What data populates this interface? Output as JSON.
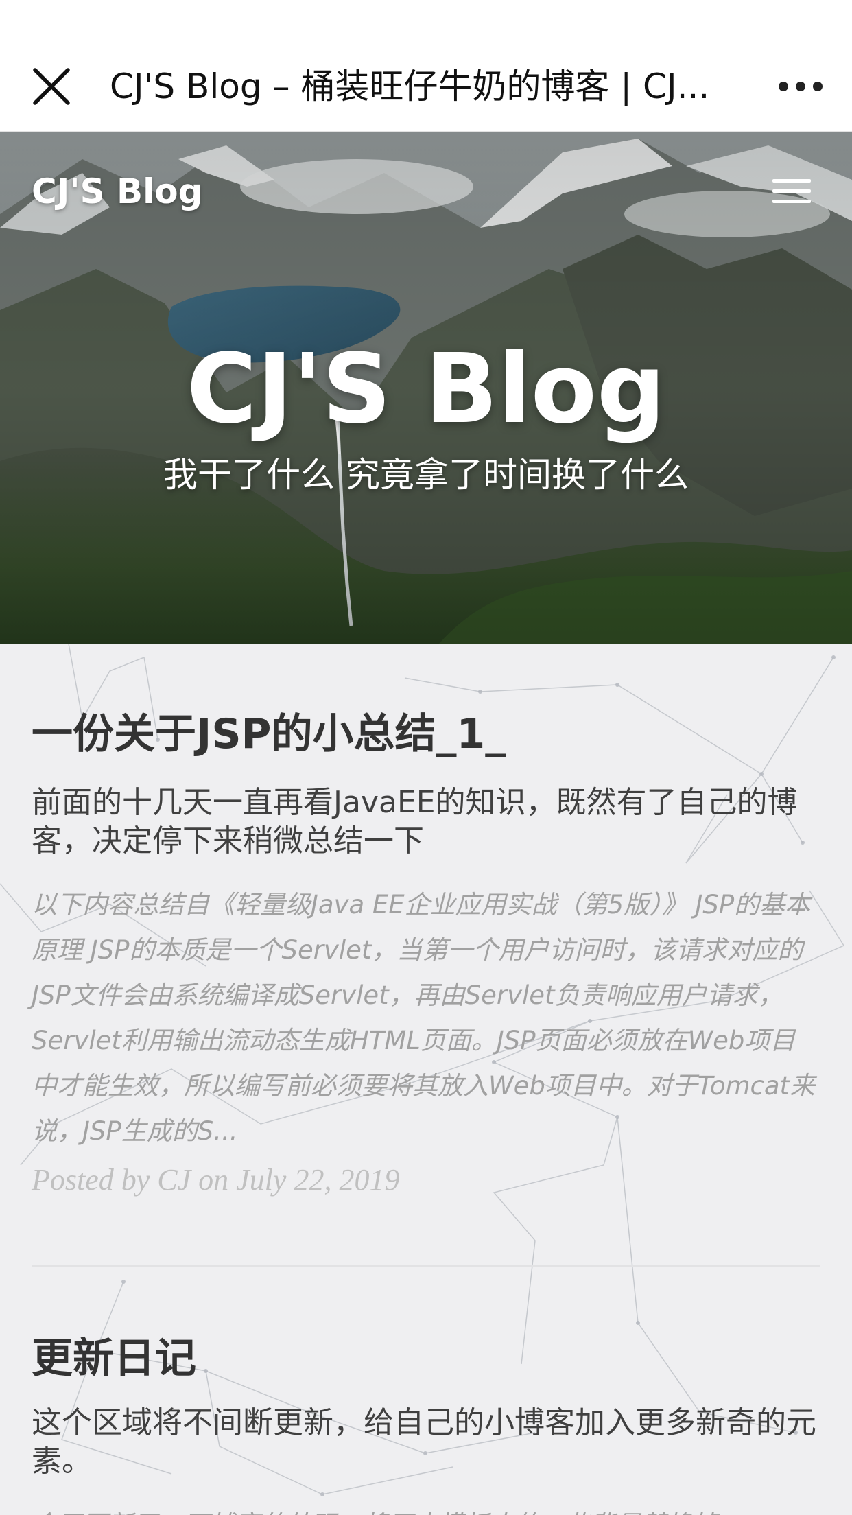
{
  "topbar": {
    "title": "CJ'S Blog – 桶装旺仔牛奶的博客 | CJ..."
  },
  "hero": {
    "brand": "CJ'S Blog",
    "title": "CJ'S Blog",
    "subtitle": "我干了什么 究竟拿了时间换了什么"
  },
  "posts": [
    {
      "title": "一份关于JSP的小总结_1_",
      "subtitle": "前面的十几天一直再看JavaEE的知识，既然有了自己的博客，决定停下来稍微总结一下",
      "excerpt": "以下内容总结自《轻量级Java EE企业应用实战（第5版）》 JSP的基本原理 JSP的本质是一个Servlet，当第一个用户访问时，该请求对应的JSP文件会由系统编译成Servlet，再由Servlet负责响应用户请求， Servlet利用输出流动态生成HTML页面。JSP页面必须放在Web项目中才能生效，所以编写前必须要将其放入Web项目中。对于Tomcat来说，JSP生成的S...",
      "meta": "Posted by CJ on July 22, 2019"
    },
    {
      "title": "更新日记",
      "subtitle": "这个区域将不间断更新，给自己的小博客加入更多新奇的元素。",
      "excerpt": "今天更新了一下博客的外观，将原本模板中的一些背景替换掉"
    }
  ],
  "colors": {
    "topbar_bg": "#ffffff",
    "content_bg": "#efeff1",
    "title_text": "#333333",
    "excerpt_text": "#a1a1a1"
  },
  "icons": {
    "close": "close-icon",
    "more": "more-dots-icon",
    "menu": "hamburger-menu-icon"
  }
}
